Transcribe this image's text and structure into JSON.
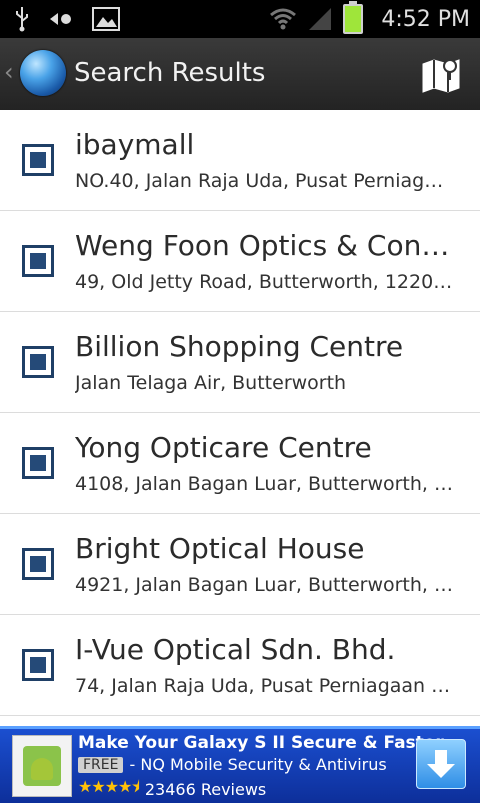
{
  "status_bar": {
    "time": "4:52 PM",
    "icons": [
      "usb-icon",
      "wifi-icon",
      "image-icon",
      "wifi-signal-icon",
      "cell-signal-icon",
      "battery-charging-icon"
    ]
  },
  "action_bar": {
    "title": "Search Results",
    "back_icon": "chevron-left-icon",
    "app_icon": "globe-icon",
    "map_icon": "map-icon"
  },
  "results": [
    {
      "title": "ibaymall",
      "subtitle": "NO.40, Jalan Raja Uda, Pusat Perniag…"
    },
    {
      "title": "Weng Foon Optics & Cont…",
      "subtitle": "49, Old Jetty Road, Butterworth, 1220…"
    },
    {
      "title": "Billion Shopping Centre",
      "subtitle": "Jalan Telaga Air, Butterworth"
    },
    {
      "title": "Yong Opticare Centre",
      "subtitle": "4108, Jalan Bagan Luar, Butterworth, …"
    },
    {
      "title": "Bright Optical House",
      "subtitle": "4921, Jalan Bagan Luar, Butterworth, …"
    },
    {
      "title": "I-Vue Optical Sdn. Bhd.",
      "subtitle": "74, Jalan Raja Uda, Pusat Perniagaan …"
    }
  ],
  "ad": {
    "headline": "Make Your Galaxy S II Secure & Faster",
    "badge": "FREE",
    "product": "- NQ Mobile Security & Antivirus",
    "rating_stars": 4.5,
    "reviews": "23466 Reviews",
    "download_icon": "download-arrow-icon"
  }
}
